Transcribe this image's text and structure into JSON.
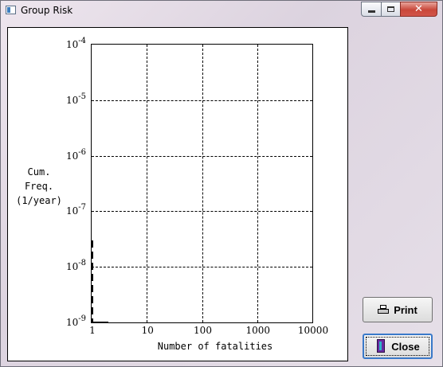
{
  "window": {
    "title": "Group Risk",
    "close_glyph": "✕"
  },
  "buttons": {
    "print_label": "Print",
    "close_label": "Close"
  },
  "chart_data": {
    "type": "line",
    "xlabel": "Number of fatalities",
    "ylabel_line1": "Cum. Freq.",
    "ylabel_line2": "(1/year)",
    "x_scale": "log",
    "y_scale": "log",
    "xlim": [
      1,
      10000
    ],
    "ylim": [
      1e-09,
      0.0001
    ],
    "x_ticks": [
      "1",
      "10",
      "100",
      "1000",
      "10000"
    ],
    "y_ticks": [
      {
        "base": "10",
        "exp": "-4"
      },
      {
        "base": "10",
        "exp": "-5"
      },
      {
        "base": "10",
        "exp": "-6"
      },
      {
        "base": "10",
        "exp": "-7"
      },
      {
        "base": "10",
        "exp": "-8"
      },
      {
        "base": "10",
        "exp": "-9"
      }
    ],
    "grid": true,
    "series": [
      {
        "points": [
          {
            "x": 1,
            "y": 3e-08
          },
          {
            "x": 1,
            "y": 1e-09
          },
          {
            "x": 2,
            "y": 1e-09
          }
        ]
      }
    ]
  }
}
